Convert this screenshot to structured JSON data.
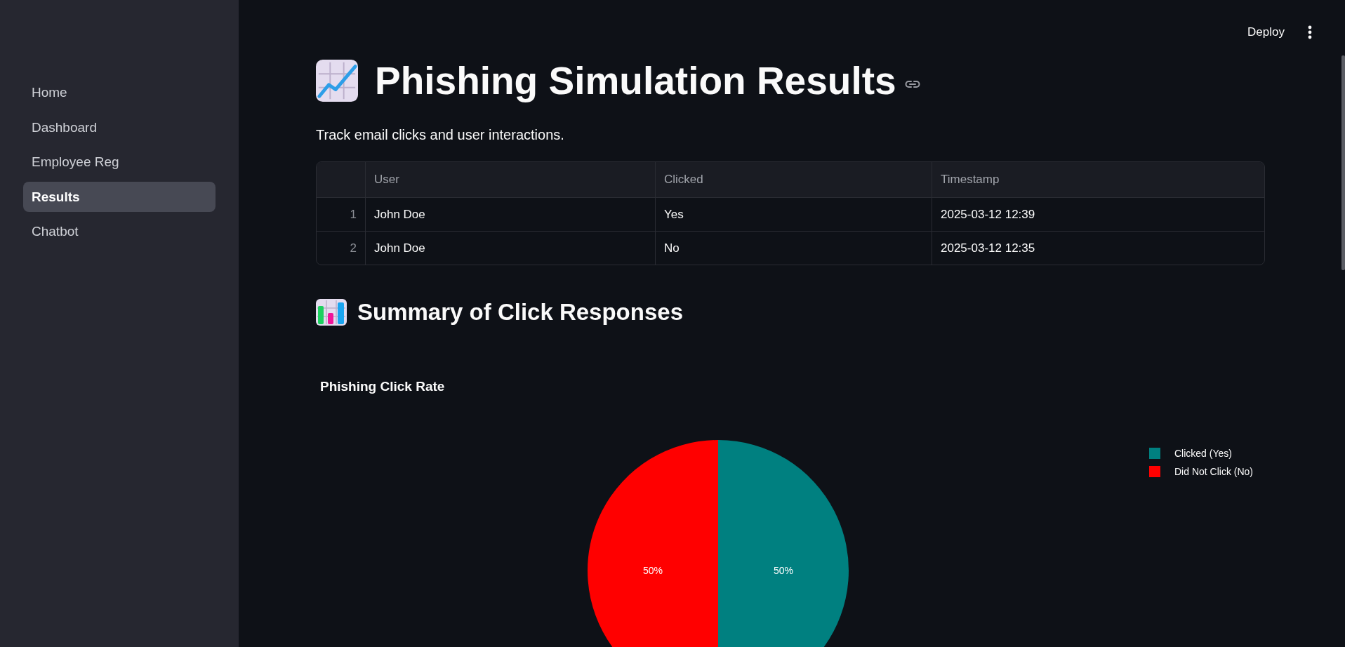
{
  "sidebar": {
    "items": [
      {
        "label": "Home",
        "selected": false
      },
      {
        "label": "Dashboard",
        "selected": false
      },
      {
        "label": "Employee Reg",
        "selected": false
      },
      {
        "label": "Results",
        "selected": true
      },
      {
        "label": "Chatbot",
        "selected": false
      }
    ]
  },
  "header": {
    "deploy_button": "Deploy"
  },
  "page": {
    "title": "Phishing Simulation Results",
    "subtitle": "Track email clicks and user interactions."
  },
  "table": {
    "columns": [
      "User",
      "Clicked",
      "Timestamp"
    ],
    "rows": [
      {
        "index": "1",
        "cells": [
          "John Doe",
          "Yes",
          "2025-03-12 12:39"
        ]
      },
      {
        "index": "2",
        "cells": [
          "John Doe",
          "No",
          "2025-03-12 12:35"
        ]
      }
    ]
  },
  "summary": {
    "heading": "Summary of Click Responses",
    "chart_data": {
      "type": "pie",
      "title": "Phishing Click Rate",
      "categories": [
        "Clicked (Yes)",
        "Did Not Click (No)"
      ],
      "values": [
        50,
        50
      ],
      "value_labels": [
        "50%",
        "50%"
      ],
      "legend": "right"
    },
    "slices": [
      {
        "color": "#008080"
      },
      {
        "color": "#ff0000"
      }
    ]
  }
}
